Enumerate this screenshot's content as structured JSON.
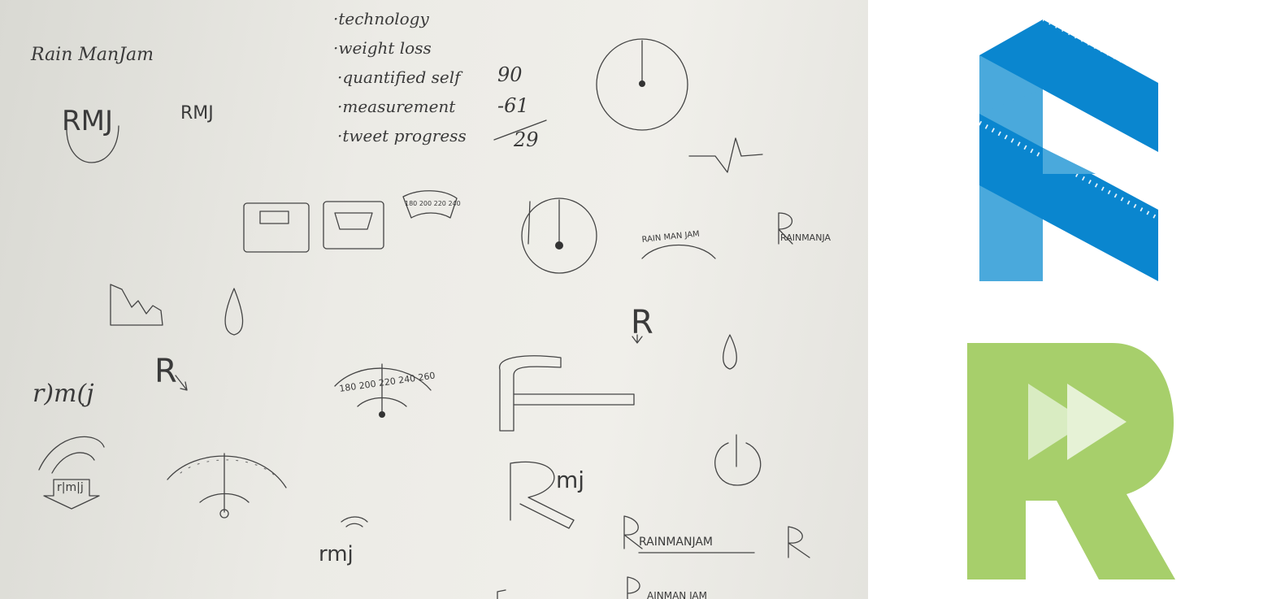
{
  "sketch": {
    "brand_name": "Rain ManJam",
    "keywords": [
      "·technology",
      "·weight loss",
      "·quantified self",
      "·measurement",
      "·tweet progress"
    ],
    "math": {
      "a": "90",
      "b": "-61",
      "result": "29"
    },
    "rmj_logo_a": "RMJ",
    "rmj_logo_b": "RMJ",
    "scale_ticks": "180 200 220 240",
    "scale_ticks_b": "180 200 220 240 260",
    "arc_text": "RAIN MAN JAM",
    "wordmark_side": "RAINMANJA",
    "wordmark_bottom": "RAINMANJAM",
    "wordmark_cut": "AINMAN JAM",
    "r_letter": "R",
    "rmj_paren": "r)m(j",
    "rmj_box": "r|m|j",
    "rmj_lower": "rmj",
    "r_mj": "mj"
  },
  "colors": {
    "blue_dark": "#0a86cf",
    "blue_light": "#4aa9dc",
    "green": "#a7cf6b",
    "green_light": "#d9ecc2"
  }
}
